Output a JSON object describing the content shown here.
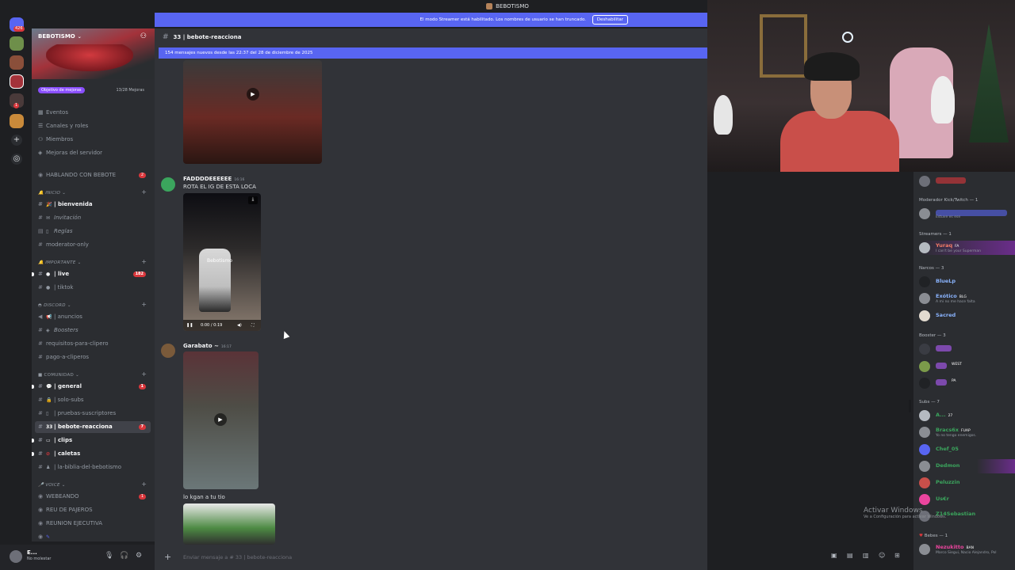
{
  "window": {
    "title": "BEBOTISMO"
  },
  "streamer_banner": {
    "text": "El modo Streamer está habilitado. Los nombres de usuario se han truncado.",
    "button": "Deshabilitar"
  },
  "rail": {
    "badges": [
      "426",
      "1"
    ]
  },
  "server": {
    "name": "BEBOTISMO",
    "boost_goal": "Objetivo de mejoras",
    "boost_count": "13/28 Mejoras",
    "menu": [
      "Eventos",
      "Canales y roles",
      "Miembros",
      "Mejoras del servidor"
    ],
    "voice_top": {
      "label": "HABLANDO CON BEBOTE",
      "count": "2"
    }
  },
  "categories": {
    "inicio": "INICIO",
    "importante": "IMPORTANTE",
    "discord": "DISCORD",
    "comunidad": "COMUNIDAD",
    "voice": "VOICE"
  },
  "channels": {
    "bienvenida": "| bienvenida",
    "invitacion": "Invitación",
    "reglas": "Reglas",
    "moderator": "moderator-only",
    "live": {
      "label": "| live",
      "count": "182"
    },
    "tiktok": "| tiktok",
    "anuncios": "| anuncios",
    "boosters": "Boosters",
    "requisitos": "requisitos-para-clipero",
    "pago": "pago-a-cliperos",
    "general": {
      "label": "| general",
      "count": "1"
    },
    "solo_subs": "| solo-subs",
    "pruebas": "| pruebas-suscriptores",
    "bebote": {
      "label": "| bebote-reacciona",
      "count": "7"
    },
    "clips": "| clips",
    "caletas": "| caletas",
    "biblia": "| la-biblia-del-bebotismo",
    "webeando": {
      "label": "WEBEANDO",
      "count": "1"
    },
    "reu": "REU DE PAJEROS",
    "reunion": "REUNION EJECUTIVA"
  },
  "user": {
    "name": "E...",
    "status": "No molestar"
  },
  "chat": {
    "channel": "| bebote-reacciona",
    "new_messages": "154 mensajes nuevos desde las 22:37 del 28 de diciembre de 2025",
    "msg1": {
      "author": "FADDDDEEEEEE",
      "time": "16:16",
      "text": "ROTA EL IG DE ESTA LOCA",
      "video_time": "0:00 / 0:19",
      "watermark": "Bebotismo"
    },
    "msg2": {
      "author": "Garabato ~",
      "time": "16:17",
      "text": "lo kgan a tu tio"
    },
    "composer_placeholder": "Enviar mensaje a #",
    "composer_channel": "bebote-reacciona"
  },
  "members": {
    "groups": {
      "mods": "Moderador Kick/Twitch — 1",
      "streamers": "Streamers — 1",
      "narcos": "Narcos",
      "narcos_count": "— 3",
      "booster": "Booster — 3",
      "subs": "Subs — 7",
      "bebes": "Bebes — 1"
    },
    "mod_status": "Estuve es ese",
    "streamer": {
      "name": "Yuraq",
      "tag": "FA",
      "status": "I can't be your Superman"
    },
    "narcos": [
      {
        "name": "BlueLp",
        "tag": "",
        "status": ""
      },
      {
        "name": "Exótico",
        "tag": "BLG",
        "status": "A mi no me hace falta"
      },
      {
        "name": "Sacred",
        "tag": "",
        "status": ""
      }
    ],
    "booster_tag": "WEST",
    "booster_tag2": "PA",
    "subs": [
      {
        "name": "A...",
        "tag": "27",
        "status": ""
      },
      {
        "name": "Bracs6x",
        "tag": "FUAP",
        "status": "Yo no tengo enemigos."
      },
      {
        "name": "Chef_05",
        "tag": "",
        "status": ""
      },
      {
        "name": "Dedmon",
        "tag": "",
        "status": ""
      },
      {
        "name": "Peluzzin",
        "tag": "",
        "status": ""
      },
      {
        "name": "Us€r",
        "tag": "",
        "status": ""
      },
      {
        "name": "Z14Sebastian",
        "tag": "",
        "status": ""
      }
    ],
    "bebe": {
      "name": "Nezukitto",
      "tag": "BAN",
      "status": "Marco Siegui, Nacio Alejandro, Pol"
    }
  },
  "watermark": {
    "line1": "Activar Windows",
    "line2": "Ve a Configuración para activar Windows."
  },
  "colors": {
    "accent": "#5865f2",
    "unread_badge": "#da373c",
    "online_green": "#3ba55d"
  }
}
